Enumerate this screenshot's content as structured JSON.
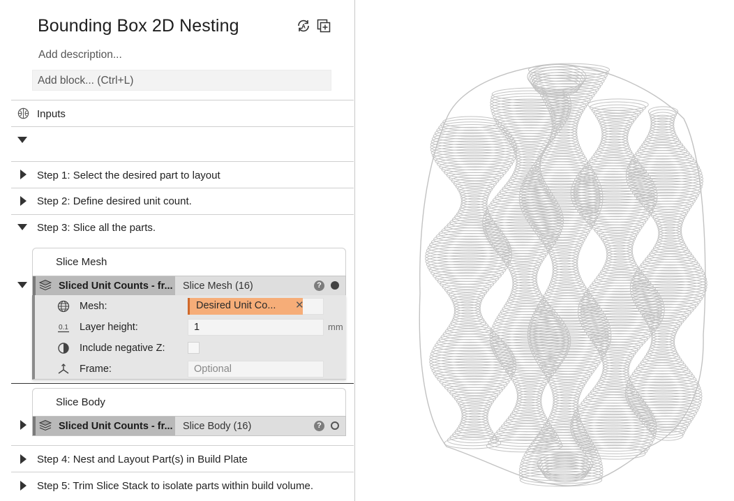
{
  "header": {
    "title": "Bounding Box 2D Nesting",
    "description_placeholder": "Add description...",
    "add_block_placeholder": "Add block... (Ctrl+L)"
  },
  "inputs_section": {
    "label": "Inputs"
  },
  "steps": [
    {
      "label": "Step 1: Select the desired part to layout",
      "expanded": false
    },
    {
      "label": "Step 2: Define desired unit count.",
      "expanded": false
    },
    {
      "label": "Step 3: Slice all the parts.",
      "expanded": true
    },
    {
      "label": "Step 4: Nest and Layout Part(s) in Build Plate",
      "expanded": false
    },
    {
      "label": "Step 5: Trim Slice Stack to isolate parts within build volume.",
      "expanded": false
    }
  ],
  "slice_mesh": {
    "card_title": "Slice Mesh",
    "block_output": "Sliced Unit Counts - fr...",
    "block_name": "Slice Mesh (16)",
    "help": "?",
    "params": {
      "mesh_label": "Mesh:",
      "mesh_value": "Desired Unit Co...",
      "layer_height_label": "Layer height:",
      "layer_height_value": "1",
      "layer_height_unit": "mm",
      "include_negative_z_label": "Include negative Z:",
      "frame_label": "Frame:",
      "frame_placeholder": "Optional"
    }
  },
  "slice_body": {
    "card_title": "Slice Body",
    "block_output": "Sliced Unit Counts - fr...",
    "block_name": "Slice Body (16)",
    "help": "?"
  },
  "colors": {
    "accent_chip": "#f6ad78",
    "accent_chip_border": "#d0692a",
    "viewport_lines": "#b8b8b8"
  }
}
